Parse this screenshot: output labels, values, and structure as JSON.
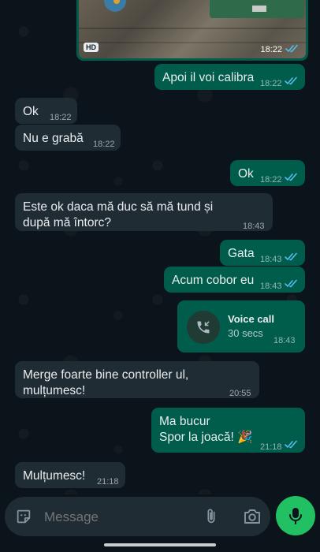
{
  "colors": {
    "background": "#0b141a",
    "incoming_bubble": "#202c33",
    "outgoing_bubble": "#005c4b",
    "read_ticks": "#53bdeb",
    "mic_button": "#21c063"
  },
  "messages": [
    {
      "type": "image",
      "direction": "out",
      "badge": "HD",
      "time": "18:22",
      "status": "read"
    },
    {
      "direction": "out",
      "text": "Apoi il voi calibra",
      "time": "18:22",
      "status": "read"
    },
    {
      "direction": "in",
      "text": "Ok",
      "time": "18:22"
    },
    {
      "direction": "in",
      "text": "Nu e grabă",
      "time": "18:22"
    },
    {
      "direction": "out",
      "text": "Ok",
      "time": "18:22",
      "status": "read"
    },
    {
      "direction": "in",
      "text": "Este ok daca mă duc să mă tund și după mă întorc?",
      "time": "18:43"
    },
    {
      "direction": "out",
      "text": "Gata",
      "time": "18:43",
      "status": "read"
    },
    {
      "direction": "out",
      "text": "Acum cobor eu",
      "time": "18:43",
      "status": "read"
    },
    {
      "type": "call",
      "direction": "out",
      "title": "Voice call",
      "duration": "30 secs",
      "time": "18:43",
      "icon": "incoming-call-icon"
    },
    {
      "direction": "in",
      "text": "Merge foarte bine controller ul, mulțumesc!",
      "time": "20:55"
    },
    {
      "direction": "out",
      "line1": "Ma bucur",
      "line2": "Spor la joacă! 🎉",
      "time": "21:18",
      "status": "read"
    },
    {
      "direction": "in",
      "text": "Mulțumesc!",
      "time": "21:18"
    }
  ],
  "composer": {
    "placeholder": "Message",
    "sticker_icon": "sticker-icon",
    "attach_icon": "paperclip-icon",
    "camera_icon": "camera-icon",
    "mic_icon": "mic-icon"
  }
}
